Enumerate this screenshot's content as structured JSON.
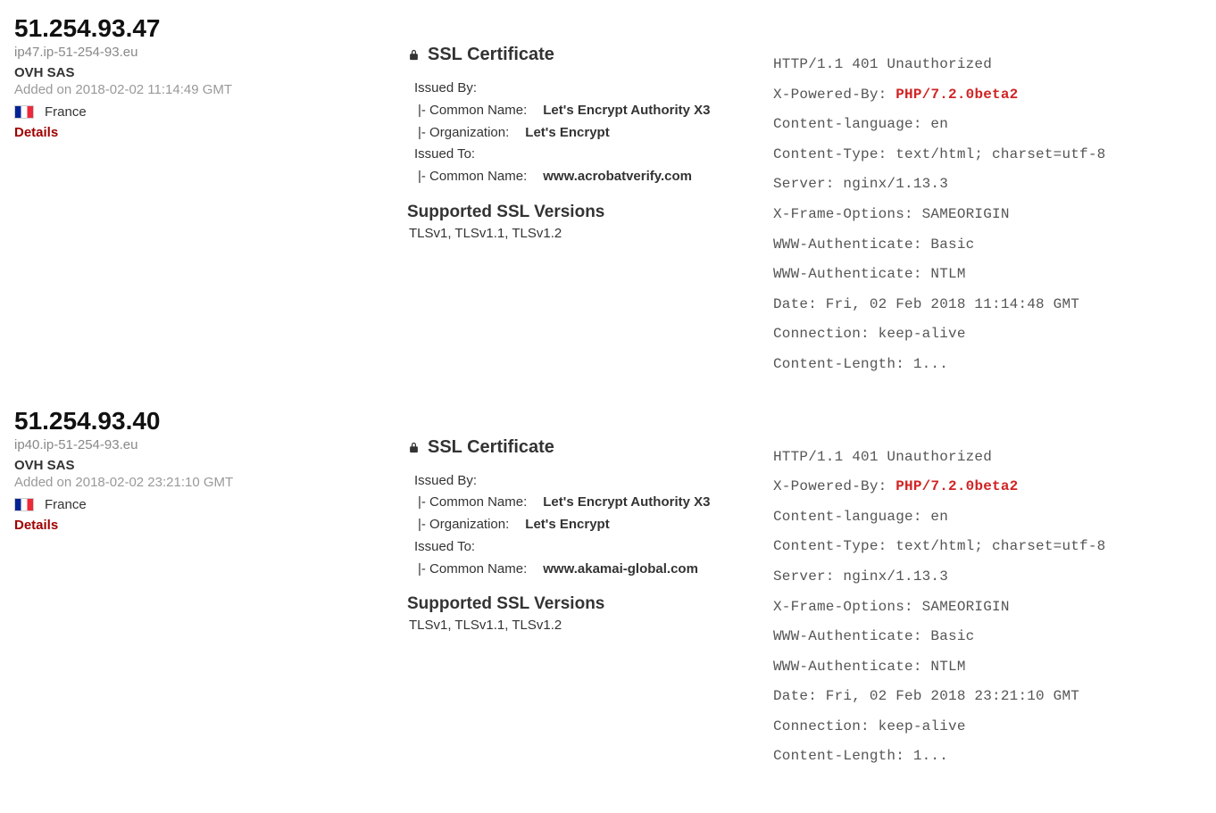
{
  "results": [
    {
      "ip": "51.254.93.47",
      "hostname": "ip47.ip-51-254-93.eu",
      "org": "OVH SAS",
      "added": "Added on 2018-02-02 11:14:49 GMT",
      "country": "France",
      "details_label": "Details",
      "ssl": {
        "heading": "SSL Certificate",
        "issued_by_label": "Issued By:",
        "issued_by_cn_label": "|- Common Name:",
        "issued_by_cn_value": "Let's Encrypt Authority X3",
        "issued_by_org_label": "|- Organization:",
        "issued_by_org_value": "Let's Encrypt",
        "issued_to_label": "Issued To:",
        "issued_to_cn_label": "|- Common Name:",
        "issued_to_cn_value": "www.acrobatverify.com",
        "versions_heading": "Supported SSL Versions",
        "versions": "TLSv1, TLSv1.1, TLSv1.2"
      },
      "headers": {
        "status": "HTTP/1.1 401 Unauthorized",
        "powered_label": "X-Powered-By: ",
        "powered_value": "PHP/7.2.0beta2",
        "lines_rest": "Content-language: en\nContent-Type: text/html; charset=utf-8\nServer: nginx/1.13.3\nX-Frame-Options: SAMEORIGIN\nWWW-Authenticate: Basic\nWWW-Authenticate: NTLM\nDate: Fri, 02 Feb 2018 11:14:48 GMT\nConnection: keep-alive\nContent-Length: 1..."
      }
    },
    {
      "ip": "51.254.93.40",
      "hostname": "ip40.ip-51-254-93.eu",
      "org": "OVH SAS",
      "added": "Added on 2018-02-02 23:21:10 GMT",
      "country": "France",
      "details_label": "Details",
      "ssl": {
        "heading": "SSL Certificate",
        "issued_by_label": "Issued By:",
        "issued_by_cn_label": "|- Common Name:",
        "issued_by_cn_value": "Let's Encrypt Authority X3",
        "issued_by_org_label": "|- Organization:",
        "issued_by_org_value": "Let's Encrypt",
        "issued_to_label": "Issued To:",
        "issued_to_cn_label": "|- Common Name:",
        "issued_to_cn_value": "www.akamai-global.com",
        "versions_heading": "Supported SSL Versions",
        "versions": "TLSv1, TLSv1.1, TLSv1.2"
      },
      "headers": {
        "status": "HTTP/1.1 401 Unauthorized",
        "powered_label": "X-Powered-By: ",
        "powered_value": "PHP/7.2.0beta2",
        "lines_rest": "Content-language: en\nContent-Type: text/html; charset=utf-8\nServer: nginx/1.13.3\nX-Frame-Options: SAMEORIGIN\nWWW-Authenticate: Basic\nWWW-Authenticate: NTLM\nDate: Fri, 02 Feb 2018 23:21:10 GMT\nConnection: keep-alive\nContent-Length: 1..."
      }
    }
  ]
}
